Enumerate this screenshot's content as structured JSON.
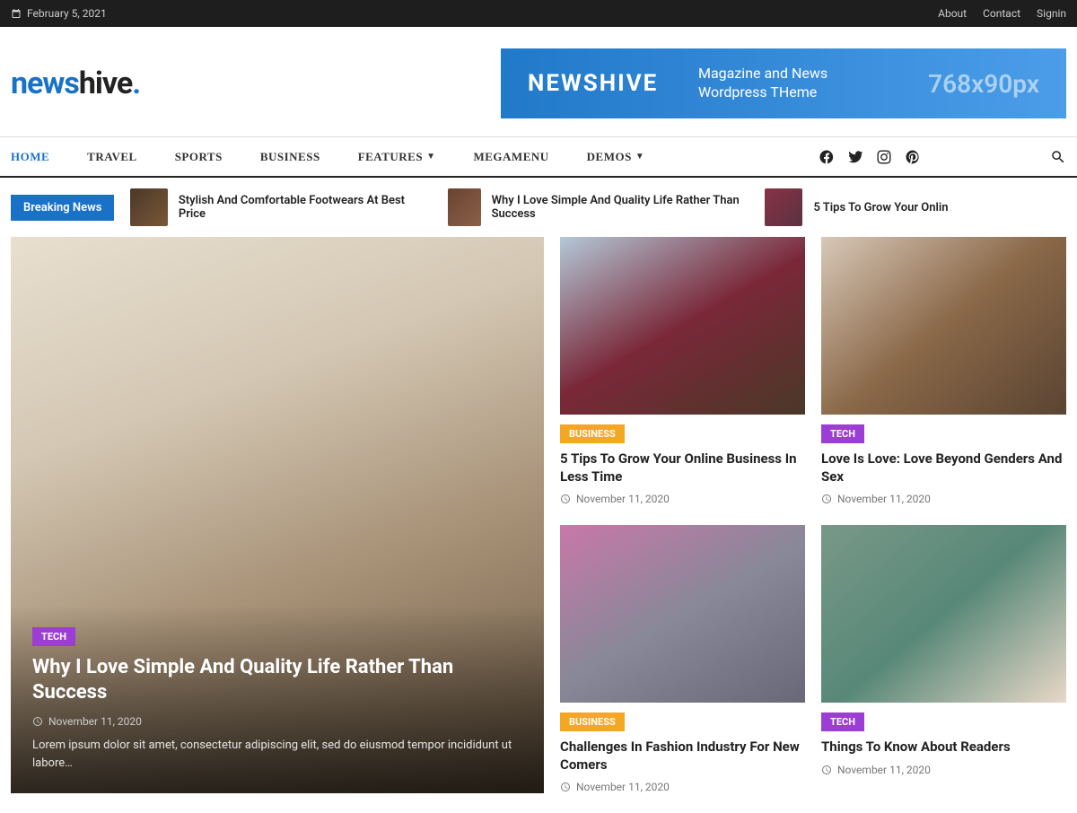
{
  "topbar": {
    "date": "February 5, 2021",
    "links": [
      "About",
      "Contact",
      "Signin"
    ]
  },
  "logo": {
    "news": "news",
    "hive": "hive",
    "dot": "."
  },
  "banner": {
    "title": "NEWSHIVE",
    "sub1": "Magazine and News",
    "sub2": "Wordpress THeme",
    "dim": "768x90px"
  },
  "nav": {
    "items": [
      "HOME",
      "TRAVEL",
      "SPORTS",
      "BUSINESS",
      "FEATURES",
      "MEGAMENU",
      "DEMOS"
    ]
  },
  "ticker": {
    "label": "Breaking News",
    "items": [
      "Stylish And Comfortable Footwears At Best Price",
      "Why I Love Simple And Quality Life Rather Than Success",
      "5 Tips To Grow Your Onlin"
    ]
  },
  "hero": {
    "tag": "TECH",
    "title": "Why I Love Simple And Quality Life Rather Than Success",
    "date": "November 11, 2020",
    "excerpt": "Lorem ipsum dolor sit amet, consectetur adipiscing elit, sed do eiusmod tempor incididunt ut labore…"
  },
  "cards": [
    {
      "tag": "BUSINESS",
      "tagClass": "business",
      "title": "5 Tips To Grow Your Online Business In Less Time",
      "date": "November 11, 2020"
    },
    {
      "tag": "TECH",
      "tagClass": "tech",
      "title": "Love Is Love: Love Beyond Genders And Sex",
      "date": "November 11, 2020"
    },
    {
      "tag": "BUSINESS",
      "tagClass": "business",
      "title": "Challenges In Fashion Industry For New Comers",
      "date": "November 11, 2020"
    },
    {
      "tag": "TECH",
      "tagClass": "tech",
      "title": "Things To Know About Readers",
      "date": "November 11, 2020"
    }
  ]
}
